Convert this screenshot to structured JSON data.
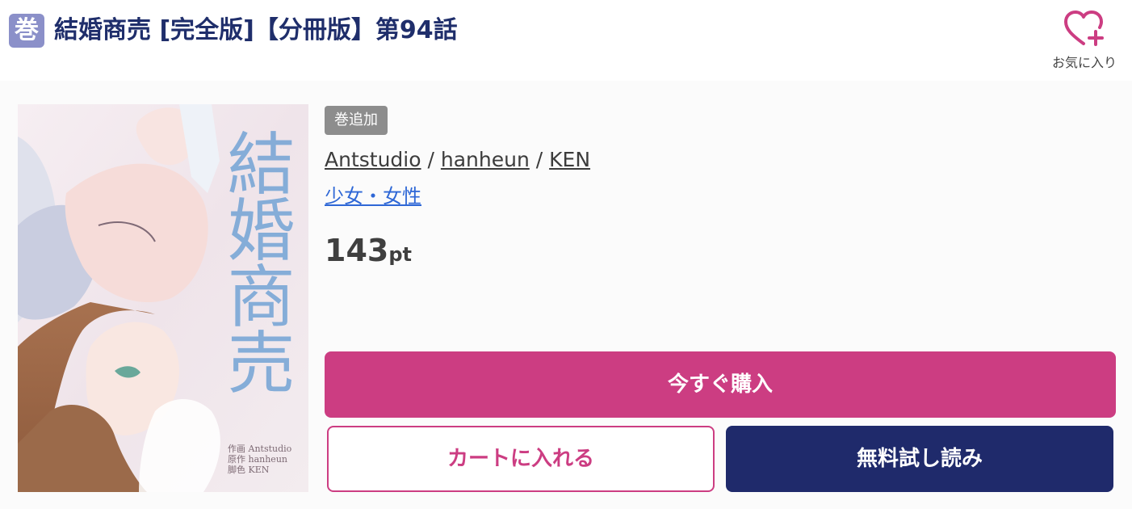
{
  "header": {
    "type_badge": "巻",
    "title": "結婚商売 [完全版]【分冊版】第94話",
    "favorite_label": "お気に入り"
  },
  "cover": {
    "title": "結婚商売",
    "credits": [
      "作画 Antstudio",
      "原作 hanheun",
      "脚色 KEN"
    ]
  },
  "product": {
    "status_badge": "巻追加",
    "authors": [
      "Antstudio",
      "hanheun",
      "KEN"
    ],
    "author_separator": " / ",
    "genre": "少女・女性",
    "price_value": "143",
    "price_unit": "pt"
  },
  "actions": {
    "buy_now": "今すぐ購入",
    "add_to_cart": "カートに入れる",
    "free_trial": "無料試し読み"
  },
  "colors": {
    "title": "#1f2e6b",
    "accent_pink": "#cc3d82",
    "navy": "#1f2a6b",
    "genre_link": "#2e67d6",
    "badge_gray": "#8d8d8d"
  },
  "icons": {
    "favorite": "heart-plus-icon"
  }
}
